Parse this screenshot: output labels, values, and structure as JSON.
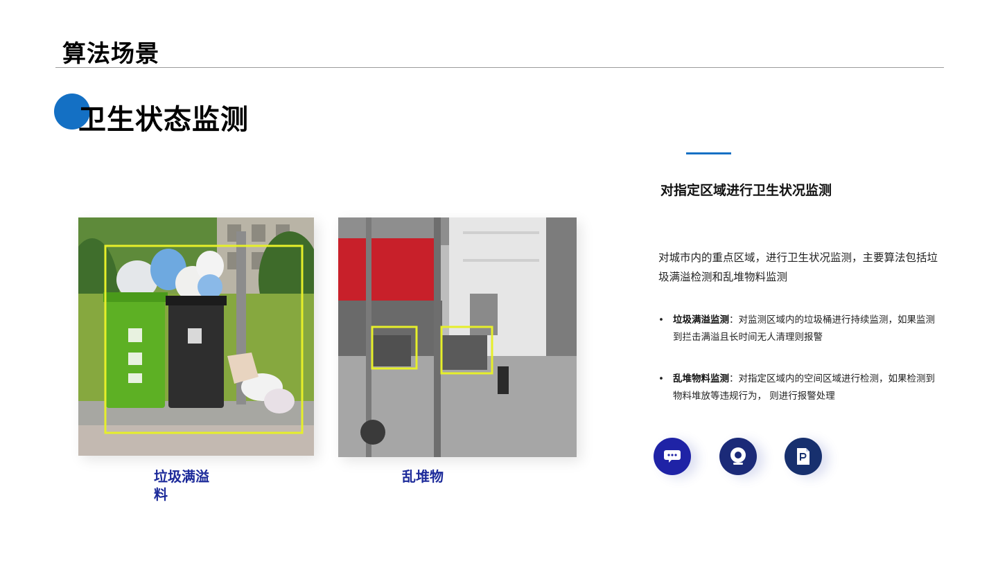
{
  "page": {
    "title": "算法场景"
  },
  "section": {
    "title": "卫生状态监测"
  },
  "images": [
    {
      "caption": "垃圾满溢料",
      "caption_line1": "垃圾满溢",
      "caption_line2": "料"
    },
    {
      "caption": "乱堆物"
    }
  ],
  "right_panel": {
    "heading": "对指定区域进行卫生状况监测",
    "intro": "对城市内的重点区域，进行卫生状况监测，主要算法包括垃圾满溢检测和乱堆物料监测",
    "bullets": [
      {
        "term": "垃圾满溢监测",
        "text": "：对监测区域内的垃圾桶进行持续监测，如果监测到拦击满溢且长时间无人清理则报警"
      },
      {
        "term": "乱堆物料监测",
        "text": "：对指定区域内的空间区域进行检测，如果检测到物料堆放等违规行为， 则进行报警处理"
      }
    ],
    "bullet_marker": "•"
  },
  "icons": [
    "chat-icon",
    "camera-icon",
    "document-icon"
  ],
  "colors": {
    "accent": "#1470c4",
    "caption": "#1c2a9a",
    "detection_box": "#e6ef2a"
  }
}
